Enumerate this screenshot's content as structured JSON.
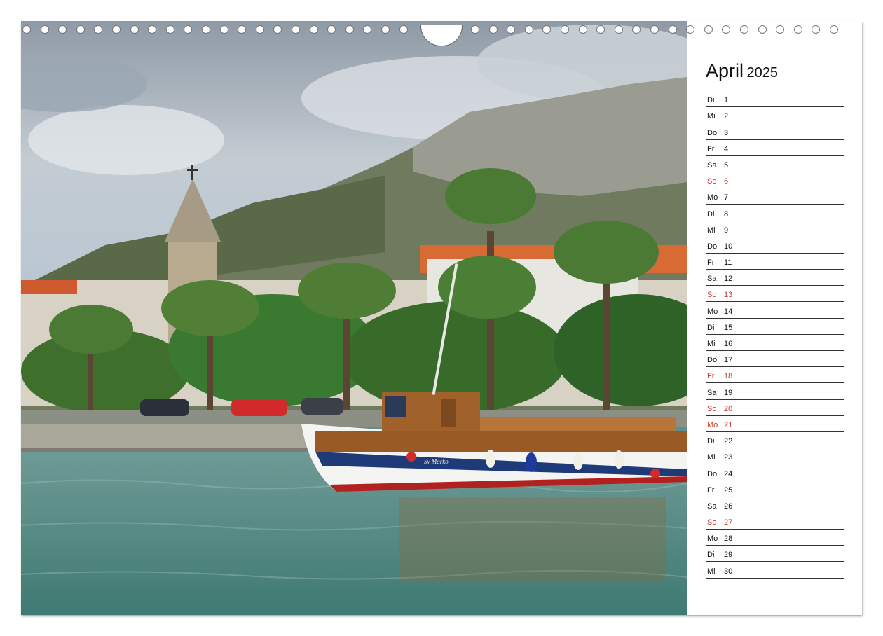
{
  "calendar": {
    "month": "April",
    "year": "2025",
    "days": [
      {
        "weekday": "Di",
        "day": "1",
        "holiday": false
      },
      {
        "weekday": "Mi",
        "day": "2",
        "holiday": false
      },
      {
        "weekday": "Do",
        "day": "3",
        "holiday": false
      },
      {
        "weekday": "Fr",
        "day": "4",
        "holiday": false
      },
      {
        "weekday": "Sa",
        "day": "5",
        "holiday": false
      },
      {
        "weekday": "So",
        "day": "6",
        "holiday": true
      },
      {
        "weekday": "Mo",
        "day": "7",
        "holiday": false
      },
      {
        "weekday": "Di",
        "day": "8",
        "holiday": false
      },
      {
        "weekday": "Mi",
        "day": "9",
        "holiday": false
      },
      {
        "weekday": "Do",
        "day": "10",
        "holiday": false
      },
      {
        "weekday": "Fr",
        "day": "11",
        "holiday": false
      },
      {
        "weekday": "Sa",
        "day": "12",
        "holiday": false
      },
      {
        "weekday": "So",
        "day": "13",
        "holiday": true
      },
      {
        "weekday": "Mo",
        "day": "14",
        "holiday": false
      },
      {
        "weekday": "Di",
        "day": "15",
        "holiday": false
      },
      {
        "weekday": "Mi",
        "day": "16",
        "holiday": false
      },
      {
        "weekday": "Do",
        "day": "17",
        "holiday": false
      },
      {
        "weekday": "Fr",
        "day": "18",
        "holiday": true
      },
      {
        "weekday": "Sa",
        "day": "19",
        "holiday": false
      },
      {
        "weekday": "So",
        "day": "20",
        "holiday": true
      },
      {
        "weekday": "Mo",
        "day": "21",
        "holiday": true
      },
      {
        "weekday": "Di",
        "day": "22",
        "holiday": false
      },
      {
        "weekday": "Mi",
        "day": "23",
        "holiday": false
      },
      {
        "weekday": "Do",
        "day": "24",
        "holiday": false
      },
      {
        "weekday": "Fr",
        "day": "25",
        "holiday": false
      },
      {
        "weekday": "Sa",
        "day": "26",
        "holiday": false
      },
      {
        "weekday": "So",
        "day": "27",
        "holiday": true
      },
      {
        "weekday": "Mo",
        "day": "28",
        "holiday": false
      },
      {
        "weekday": "Di",
        "day": "29",
        "holiday": false
      },
      {
        "weekday": "Mi",
        "day": "30",
        "holiday": false
      }
    ]
  },
  "photo": {
    "boat_name": "Sv Marko"
  },
  "colors": {
    "holiday": "#c0392b",
    "text": "#111111",
    "rule": "#333333"
  }
}
